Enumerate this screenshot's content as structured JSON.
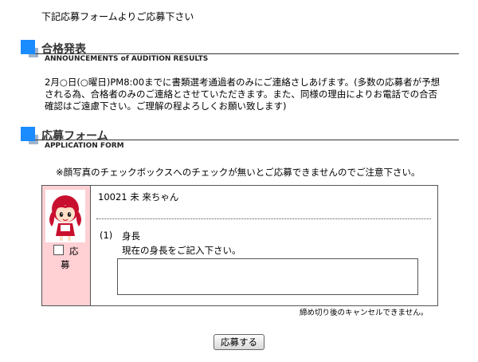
{
  "intro_text": "下記応募フォームよりご応募下さい",
  "sections": {
    "announcement": {
      "title": "合格発表",
      "subtitle": "ANNOUNCEMENTS of AUDITION RESULTS",
      "body": "2月○日(○曜日)PM8:00までに書類選考通過者のみにご連絡さしあげます。(多数の応募者が予想される為、合格者のみのご連絡とさせていただきます。また、同様の理由によりお電話での合否確認はご遠慮下さい。ご理解の程よろしくお願い致します)"
    },
    "application": {
      "title": "応募フォーム",
      "subtitle": "APPLICATION FORM",
      "notice": "※顔写真のチェックボックスへのチェックが無いとご応募できませんのでご注意下さい。"
    }
  },
  "form": {
    "entry_name": "10021 未 来ちゃん",
    "apply_checkbox": {
      "checked": false,
      "label_line1": "応",
      "label_line2": "募"
    },
    "question": {
      "number": "(1)",
      "title": "身長",
      "description": "現在の身長をご記入下さい。",
      "value": ""
    },
    "deadline_note": "締め切り後のキャンセルできません。",
    "submit_label": "応募する"
  },
  "colors": {
    "section_accent": "#1a8cff",
    "section_accent_light": "#9fb4cc",
    "photo_column_bg": "#ffd0d4"
  }
}
